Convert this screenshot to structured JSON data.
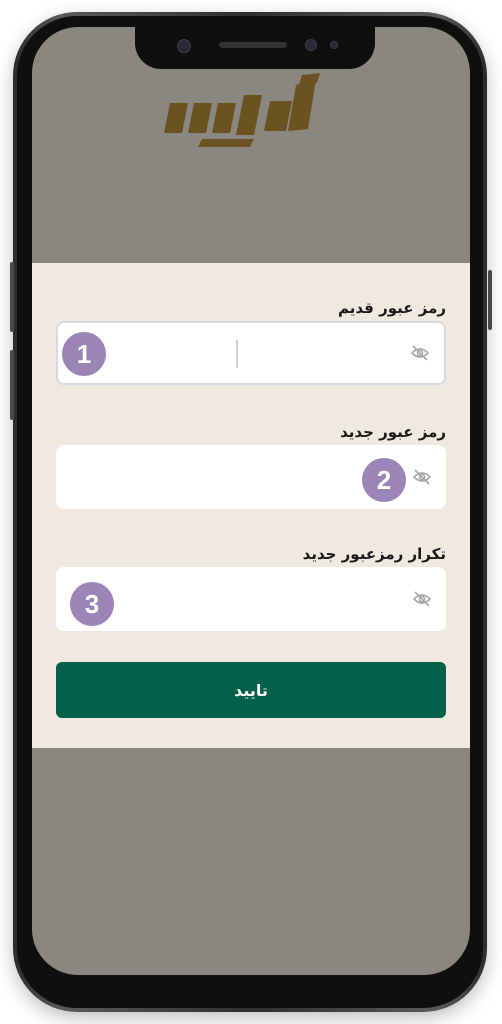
{
  "form": {
    "old_password": {
      "label": "رمز عبور قدیم",
      "value": "",
      "marker": "1"
    },
    "new_password": {
      "label": "رمز عبور جدید",
      "value": "",
      "marker": "2"
    },
    "repeat_password": {
      "label": "تکرار رمزعبور جدید",
      "value": "",
      "marker": "3"
    },
    "confirm_label": "تایید"
  },
  "icons": {
    "password_toggle": "eye-off-icon",
    "logo": "brand-logo"
  },
  "colors": {
    "confirm_button": "#04604b",
    "panel_background": "#efe9df",
    "marker": "#9a85b6",
    "logo": "#6b5220"
  }
}
